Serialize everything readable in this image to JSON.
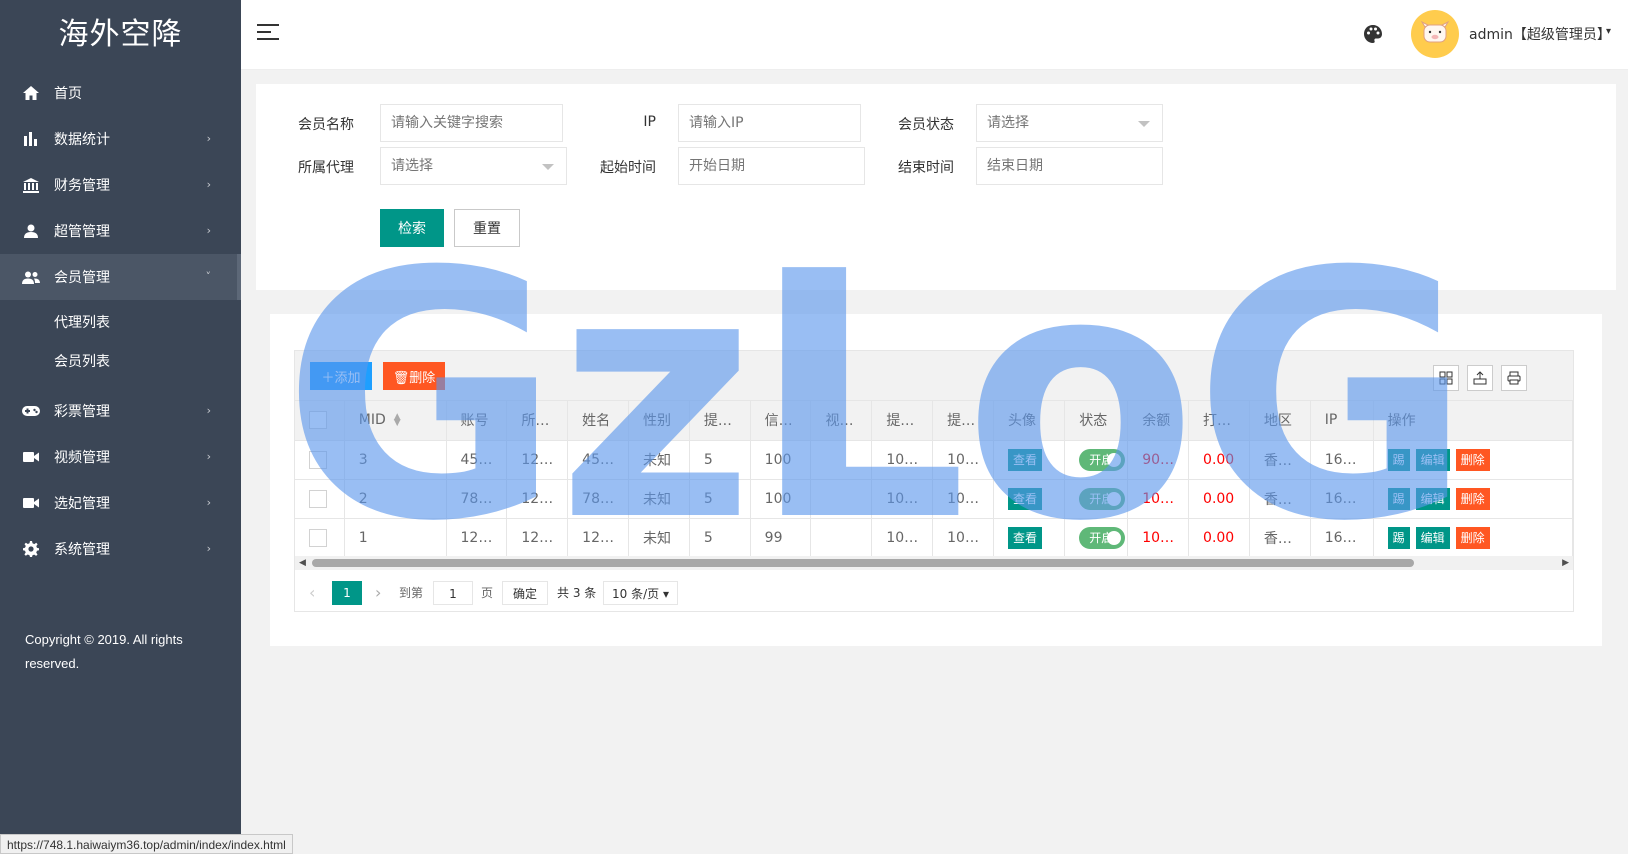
{
  "app": {
    "title": "海外空降"
  },
  "sidebar": {
    "items": [
      {
        "label": "首页",
        "icon": "home-icon",
        "arrow": ""
      },
      {
        "label": "数据统计",
        "icon": "bar-chart-icon",
        "arrow": "›"
      },
      {
        "label": "财务管理",
        "icon": "bank-icon",
        "arrow": "›"
      },
      {
        "label": "超管管理",
        "icon": "user-icon",
        "arrow": "›"
      },
      {
        "label": "会员管理",
        "icon": "users-icon",
        "arrow": "˅"
      },
      {
        "label": "彩票管理",
        "icon": "gamepad-icon",
        "arrow": "›"
      },
      {
        "label": "视频管理",
        "icon": "video-icon",
        "arrow": "›"
      },
      {
        "label": "选妃管理",
        "icon": "video-icon",
        "arrow": "›"
      },
      {
        "label": "系统管理",
        "icon": "gear-icon",
        "arrow": "›"
      }
    ],
    "sub_items": [
      "代理列表",
      "会员列表"
    ],
    "copyright": "Copyright © 2019. All rights reserved."
  },
  "header": {
    "user": "admin【超级管理员】",
    "caret": "▾"
  },
  "search": {
    "labels": {
      "name": "会员名称",
      "ip": "IP",
      "status": "会员状态",
      "agent": "所属代理",
      "start": "起始时间",
      "end": "结束时间"
    },
    "placeholders": {
      "name": "请输入关键字搜索",
      "ip": "请输入IP",
      "status": "请选择",
      "agent": "请选择",
      "start": "开始日期",
      "end": "结束日期"
    },
    "search_btn": "检索",
    "reset_btn": "重置"
  },
  "toolbar": {
    "add": "添加",
    "delete": "删除"
  },
  "table": {
    "headers": [
      "MID",
      "账号",
      "所…",
      "姓名",
      "性别",
      "提…",
      "信…",
      "视…",
      "提…",
      "提…",
      "头像",
      "状态",
      "余额",
      "打…",
      "地区",
      "IP",
      "操作"
    ],
    "rows": [
      {
        "mid": "3",
        "account": "45…",
        "agent": "12…",
        "name": "45…",
        "gender": "未知",
        "c5": "5",
        "credit": "100",
        "video": "",
        "c8": "10…",
        "c9": "10…",
        "avatar": "查看",
        "status": "开启",
        "balance": "90…",
        "c13": "0.00",
        "region": "香…",
        "ip": "16…"
      },
      {
        "mid": "2",
        "account": "78…",
        "agent": "12…",
        "name": "78…",
        "gender": "未知",
        "c5": "5",
        "credit": "100",
        "video": "",
        "c8": "10…",
        "c9": "10…",
        "avatar": "查看",
        "status": "开启",
        "balance": "10…",
        "c13": "0.00",
        "region": "香…",
        "ip": "16…"
      },
      {
        "mid": "1",
        "account": "12…",
        "agent": "12…",
        "name": "12…",
        "gender": "未知",
        "c5": "5",
        "credit": "99",
        "video": "",
        "c8": "10…",
        "c9": "10…",
        "avatar": "查看",
        "status": "开启",
        "balance": "10…",
        "c13": "0.00",
        "region": "香…",
        "ip": "16…"
      }
    ],
    "ops": {
      "b1": "踢",
      "b2": "编辑",
      "b3": "删除"
    }
  },
  "pager": {
    "current": "1",
    "goto": "到第",
    "page_input": "1",
    "page_unit": "页",
    "confirm": "确定",
    "total": "共 3 条",
    "per_page": "10 条/页"
  },
  "watermark": "GzLoG",
  "statusbar": "https://748.1.haiwaiym36.top/admin/index/index.html"
}
